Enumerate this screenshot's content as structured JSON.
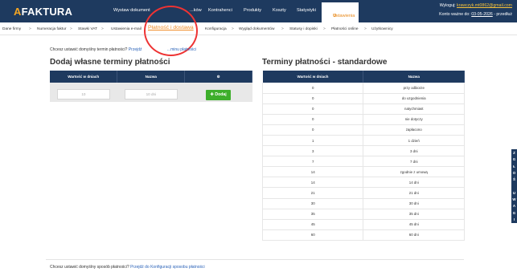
{
  "header": {
    "logo_a": "A",
    "logo_rest": "FAKTURA",
    "nav": [
      "Wystaw dokument",
      "...ków",
      "Kontrahenci",
      "Produkty",
      "Koszty",
      "Statystyki"
    ],
    "active_icon": "gear-icon",
    "active_label": "Ustawienia",
    "logout_prefix": "Wyloguj:",
    "user": "krawczyk.mt0862@gmail.com",
    "account_prefix": "Konto ważne do:",
    "account_date": "03-05-2026",
    "account_suffix": "- przedłuż"
  },
  "subnav": {
    "items": [
      "Dane firmy",
      "Numeracja faktur",
      "Stawki VAT",
      "Ustawienia e-mail"
    ],
    "active": "Płatność i dostawa",
    "items_after": [
      "Konfiguracja",
      "Wygląd dokumentów",
      "Statusy i dopiski",
      "Płatności online",
      "Użytkownicy"
    ],
    "separator": ">"
  },
  "hint_top": {
    "text": "Chcesz ustawić domyślny termin płatności?",
    "link_a": "Przejdź",
    "link_b": "...minu płatności"
  },
  "custom": {
    "title": "Dodaj własne terminy płatności",
    "col_days": "Wartość w dniach",
    "col_name": "Nazwa",
    "col_action_icon": "gear-icon",
    "days_placeholder": "10",
    "name_placeholder": "10 dni",
    "add_label": "Dodaj",
    "add_icon": "plus-icon"
  },
  "standard": {
    "title": "Terminy płatności - standardowe",
    "col_days": "Wartość w dniach",
    "col_name": "Nazwa",
    "rows": [
      {
        "days": "0",
        "name": "przy odbiorze"
      },
      {
        "days": "0",
        "name": "do uzgodnienia"
      },
      {
        "days": "0",
        "name": "natychmiast"
      },
      {
        "days": "0",
        "name": "nie dotyczy"
      },
      {
        "days": "0",
        "name": "zapłacono"
      },
      {
        "days": "1",
        "name": "1 dzień"
      },
      {
        "days": "3",
        "name": "3 dni"
      },
      {
        "days": "7",
        "name": "7 dni"
      },
      {
        "days": "14",
        "name": "zgodnie z umową"
      },
      {
        "days": "14",
        "name": "14 dni"
      },
      {
        "days": "21",
        "name": "21 dni"
      },
      {
        "days": "30",
        "name": "30 dni"
      },
      {
        "days": "35",
        "name": "35 dni"
      },
      {
        "days": "45",
        "name": "45 dni"
      },
      {
        "days": "60",
        "name": "60 dni"
      }
    ]
  },
  "hint_bottom": {
    "text": "Chcesz ustawić domyślny sposób płatności?",
    "link": "Przejdź do Konfiguracji sposobu płatności"
  },
  "side_tab": {
    "letters": [
      "Z",
      "G",
      "Ł",
      "O",
      "Ś",
      "",
      "U",
      "W",
      "A",
      "G",
      "I"
    ]
  }
}
